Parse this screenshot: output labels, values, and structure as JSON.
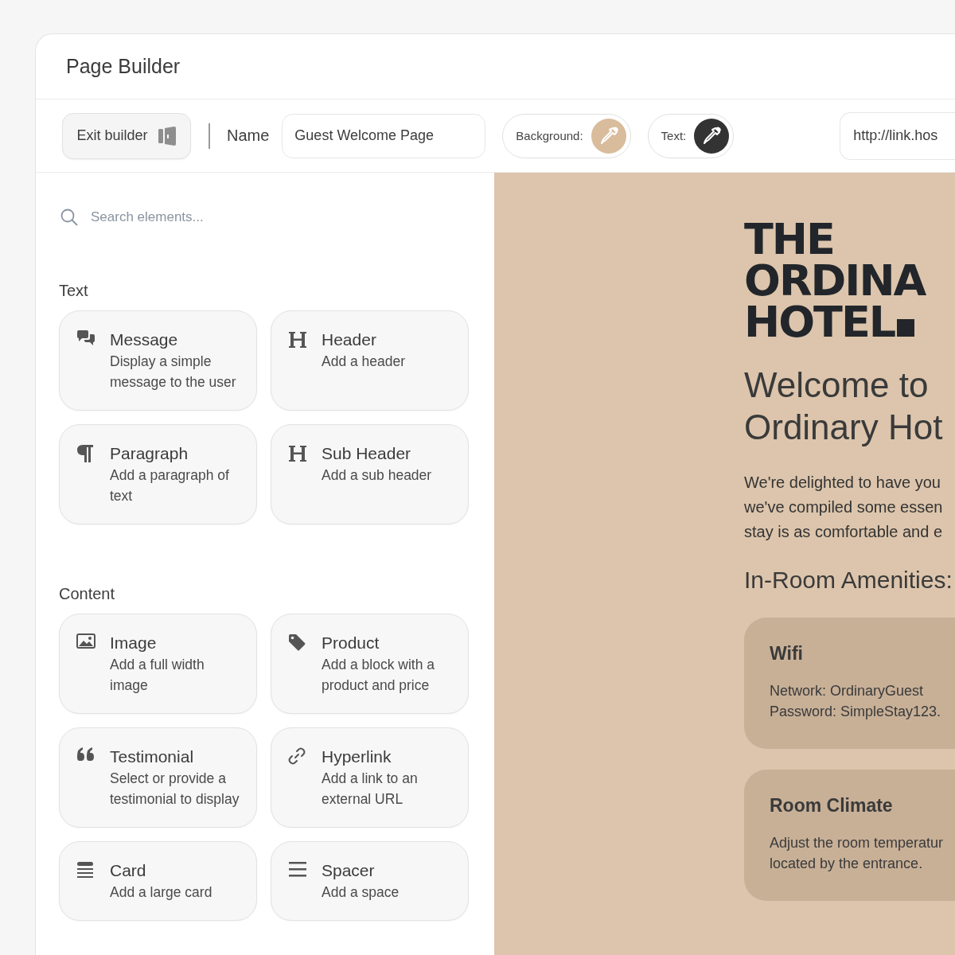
{
  "window": {
    "title": "Page Builder"
  },
  "toolbar": {
    "exit_button": "Exit builder",
    "name_label": "Name",
    "name_value": "Guest Welcome Page",
    "color_pickers": [
      {
        "label": "Background:",
        "color": "#d9bc9c"
      },
      {
        "label": "Text:",
        "color": "#333333"
      }
    ],
    "url_value": "http://link.hos"
  },
  "sidebar": {
    "search": {
      "placeholder": "Search elements..."
    },
    "sections": [
      {
        "title": "Text",
        "items": [
          {
            "kind": "message",
            "title": "Message",
            "description": "Display a simple message to the user"
          },
          {
            "kind": "heading",
            "title": "Header",
            "description": "Add a header"
          },
          {
            "kind": "paragraph",
            "title": "Paragraph",
            "description": "Add a paragraph of text"
          },
          {
            "kind": "heading",
            "title": "Sub Header",
            "description": "Add a sub header"
          }
        ]
      },
      {
        "title": "Content",
        "items": [
          {
            "kind": "image",
            "title": "Image",
            "description": "Add a full width image"
          },
          {
            "kind": "tag",
            "title": "Product",
            "description": "Add a block with a product and price"
          },
          {
            "kind": "quote",
            "title": "Testimonial",
            "description": "Select or provide a testimonial to display"
          },
          {
            "kind": "link",
            "title": "Hyperlink",
            "description": "Add a link to an external URL"
          },
          {
            "kind": "card",
            "title": "Card",
            "description": "Add a large card"
          },
          {
            "kind": "spacer",
            "title": "Spacer",
            "description": "Add a space"
          }
        ]
      }
    ]
  },
  "preview": {
    "logo_lines": [
      "THE",
      "ORDINA",
      "HOTEL"
    ],
    "heading_lines": [
      "Welcome to",
      "Ordinary Hot"
    ],
    "intro_lines": [
      "We're delighted to have you",
      "we've compiled some essen",
      "stay is as comfortable and e"
    ],
    "subheading": "In-Room Amenities:",
    "cards": [
      {
        "title": "Wifi",
        "lines": [
          "Network: OrdinaryGuest",
          "Password: SimpleStay123."
        ]
      },
      {
        "title": "Room Climate",
        "lines": [
          "Adjust the room temperatur",
          "located by the entrance."
        ]
      }
    ]
  }
}
